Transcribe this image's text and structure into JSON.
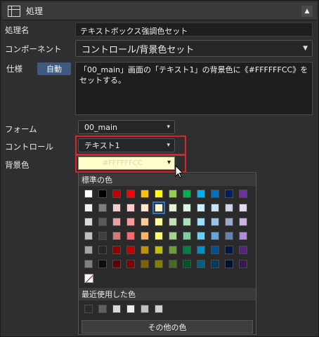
{
  "panel": {
    "title": "処理",
    "collapse_icon": "chevron-up-icon"
  },
  "form": {
    "name_label": "処理名",
    "name_value": "テキストボックス強調色セット",
    "component_label": "コンポーネント",
    "component_value": "コントロール/背景色セット",
    "spec_label": "仕様",
    "auto_button": "自動",
    "spec_text": "「00_main」画面の「テキスト1」の背景色に《#FFFFFFCC》をセットする。",
    "form_label": "フォーム",
    "form_value": "00_main",
    "control_label": "コントロール",
    "control_value": "テキスト1",
    "bgcolor_label": "背景色",
    "bgcolor_value": "#FFFFFFCC"
  },
  "palette": {
    "standard_header": "標準の色",
    "recent_header": "最近使用した色",
    "more_button": "その他の色",
    "selected_color": "#ffffcc",
    "standard_rows": [
      [
        "#ffffff",
        "#000000",
        "#c00000",
        "#ff0000",
        "#ffc000",
        "#ffff00",
        "#92d050",
        "#00b050",
        "#00b0f0",
        "#0070c0",
        "#002060",
        "#7030a0"
      ],
      [
        "#f2f2f2",
        "#7f7f7f",
        "#f4cccc",
        "#ffcccc",
        "#ffe6cc",
        "#ffffcc",
        "#e2f0d9",
        "#d9f2e4",
        "#ccf0ff",
        "#cce0f5",
        "#ccd4e6",
        "#e6d9f2"
      ],
      [
        "#d9d9d9",
        "#595959",
        "#e6a3a3",
        "#ff9999",
        "#ffcc99",
        "#ffff99",
        "#c5e0b4",
        "#a9dfbf",
        "#99e0ff",
        "#99c2eb",
        "#99aacc",
        "#ccb3e6"
      ],
      [
        "#bfbfbf",
        "#404040",
        "#d47a7a",
        "#ff6666",
        "#ffb366",
        "#ffff66",
        "#a9d18e",
        "#7dcea0",
        "#66d1ff",
        "#66a3e0",
        "#6680b3",
        "#b38cd9"
      ],
      [
        "#a6a6a6",
        "#262626",
        "#900000",
        "#bf0000",
        "#bf9000",
        "#bfbf00",
        "#6e9c3c",
        "#008040",
        "#0090c0",
        "#005090",
        "#001848",
        "#542478"
      ],
      [
        "#808080",
        "#0d0d0d",
        "#600000",
        "#800000",
        "#806000",
        "#808000",
        "#4a6828",
        "#005528",
        "#006080",
        "#003860",
        "#001030",
        "#381850"
      ]
    ],
    "recent_colors": [
      "#2a2a2a",
      "#606060",
      "#d8d8d8",
      "#ececec",
      "#c0c0c0",
      "#d0d0d0"
    ]
  }
}
